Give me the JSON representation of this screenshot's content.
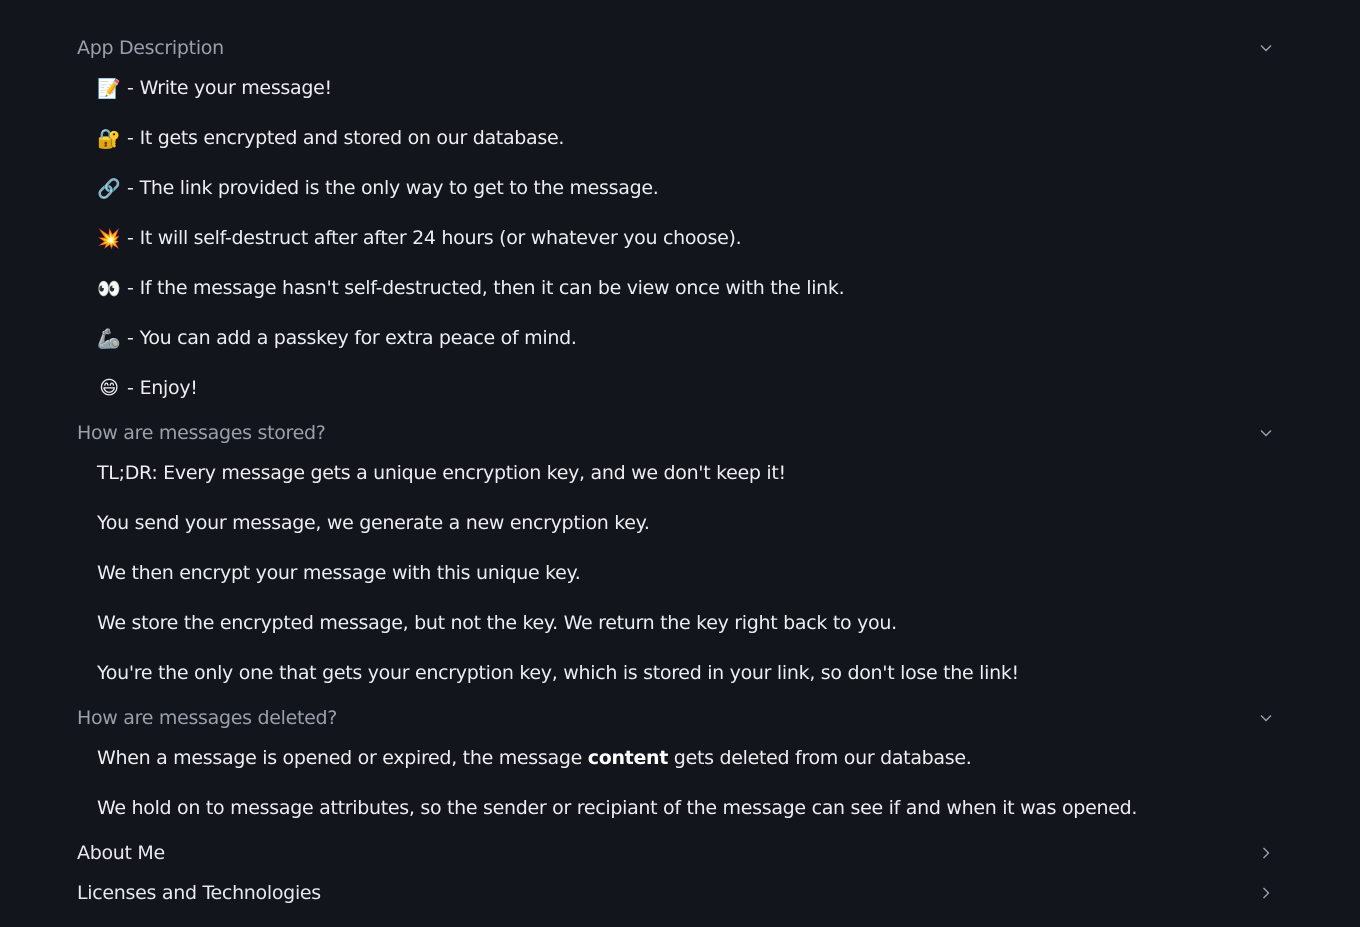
{
  "sections": [
    {
      "title": "App Description",
      "expanded": true,
      "items": [
        {
          "emoji": "📝",
          "text": "Write your message!"
        },
        {
          "emoji": "🔐",
          "text": "It gets encrypted and stored on our database."
        },
        {
          "emoji": "🔗",
          "text": "The link provided is the only way to get to the message."
        },
        {
          "emoji": "💥",
          "text": "It will self-destruct after after 24 hours (or whatever you choose)."
        },
        {
          "emoji": "👀",
          "text": "If the message hasn't self-destructed, then it can be view once with the link."
        },
        {
          "emoji": "🦾",
          "text": "You can add a passkey for extra peace of mind."
        },
        {
          "emoji": "😄",
          "text": "Enjoy!"
        }
      ]
    },
    {
      "title": "How are messages stored?",
      "expanded": true,
      "items": [
        "TL;DR: Every message gets a unique encryption key, and we don't keep it!",
        "You send your message, we generate a new encryption key.",
        "We then encrypt your message with this unique key.",
        "We store the encrypted message, but not the key. We return the key right back to you.",
        "You're the only one that gets your encryption key, which is stored in your link, so don't lose the link!"
      ]
    },
    {
      "title": "How are messages deleted?",
      "expanded": true,
      "items": [
        {
          "before": "When a message is opened or expired, the message ",
          "bold": "content",
          "after": " gets deleted from our database."
        },
        {
          "text": "We hold on to message attributes, so the sender or recipiant of the message can see if and when it was opened."
        }
      ]
    },
    {
      "title": "About Me",
      "expanded": false
    },
    {
      "title": "Licenses and Technologies",
      "expanded": false
    }
  ],
  "dash": "-",
  "icons": {
    "expanded": "chevron-down-icon",
    "collapsed": "chevron-right-icon"
  },
  "colors": {
    "background": "#13151c",
    "header_open": "#9aa0ab",
    "text": "#eceef2"
  }
}
